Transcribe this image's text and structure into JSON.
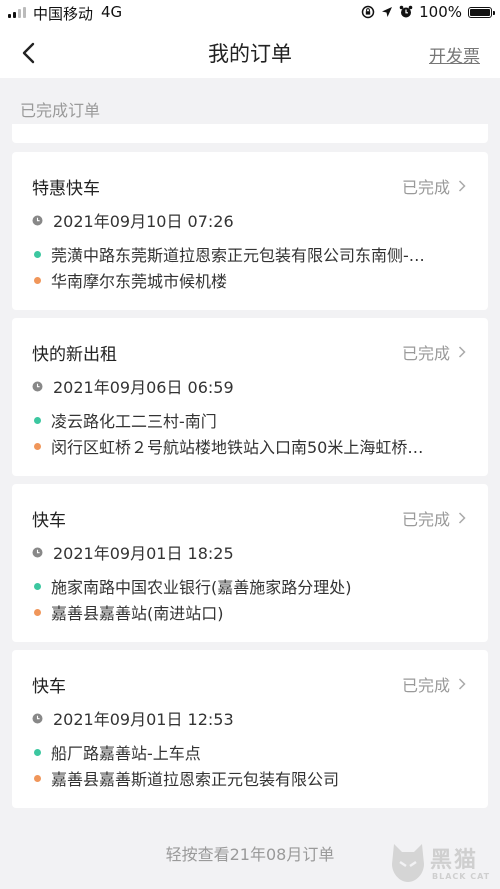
{
  "status_bar": {
    "carrier": "中国移动",
    "network": "4G",
    "battery": "100%"
  },
  "nav": {
    "title": "我的订单",
    "invoice_label": "开发票",
    "back_icon": "chevron-left-icon"
  },
  "section_label": "已完成订单",
  "orders": [
    {
      "type": "特惠快车",
      "status": "已完成",
      "time": "2021年09月10日 07:26",
      "from": "莞潢中路东莞斯道拉恩索正元包装有限公司东南侧-…",
      "to": "华南摩尔东莞城市候机楼"
    },
    {
      "type": "快的新出租",
      "status": "已完成",
      "time": "2021年09月06日 06:59",
      "from": "凌云路化工二三村-南门",
      "to": "闵行区虹桥２号航站楼地铁站入口南50米上海虹桥…"
    },
    {
      "type": "快车",
      "status": "已完成",
      "time": "2021年09月01日 18:25",
      "from": "施家南路中国农业银行(嘉善施家路分理处)",
      "to": "嘉善县嘉善站(南进站口)"
    },
    {
      "type": "快车",
      "status": "已完成",
      "time": "2021年09月01日 12:53",
      "from": "船厂路嘉善站-上车点",
      "to": "嘉善县嘉善斯道拉恩索正元包装有限公司"
    }
  ],
  "more_link": "轻按查看21年08月订单",
  "watermark": {
    "main": "黑猫",
    "sub": "BLACK CAT"
  },
  "colors": {
    "background": "#f2f2f4",
    "card": "#ffffff",
    "origin_dot": "#3cc7a0",
    "destination_dot": "#f0965a",
    "muted_text": "#9a9a9a"
  }
}
